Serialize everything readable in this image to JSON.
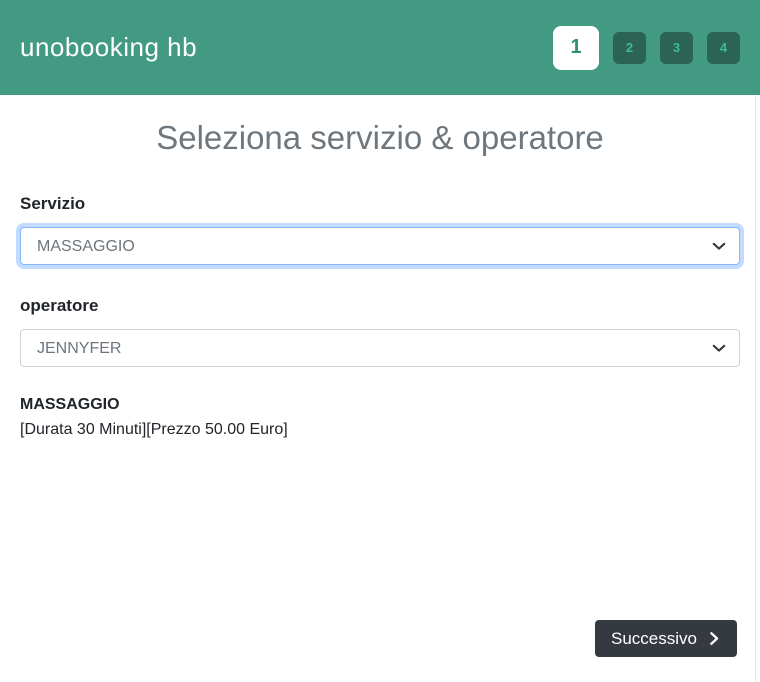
{
  "header": {
    "brand": "unobooking hb",
    "steps": [
      {
        "label": "1",
        "active": true
      },
      {
        "label": "2",
        "active": false
      },
      {
        "label": "3",
        "active": false
      },
      {
        "label": "4",
        "active": false
      }
    ]
  },
  "page": {
    "title": "Seleziona servizio & operatore"
  },
  "form": {
    "service": {
      "label": "Servizio",
      "selected": "MASSAGGIO"
    },
    "operator": {
      "label": "operatore",
      "selected": "JENNYFER"
    }
  },
  "service_info": {
    "name": "MASSAGGIO",
    "details": "[Durata 30 Minuti][Prezzo 50.00 Euro]"
  },
  "footer": {
    "next_label": "Successivo",
    "next_icon": "chevron-right"
  },
  "colors": {
    "header_bg": "#429a83",
    "step_active_bg": "#ffffff",
    "step_active_text": "#2f8e74",
    "step_inactive_bg": "#2b6355",
    "step_inactive_text": "#3fbb92",
    "title_text": "#6e777e",
    "focus_border": "#86b7fe",
    "focus_glow": "rgba(13,110,253,0.25)",
    "select_border": "#ced4da",
    "select_text": "#6c757d",
    "button_bg": "#343a40",
    "button_text": "#ffffff"
  }
}
